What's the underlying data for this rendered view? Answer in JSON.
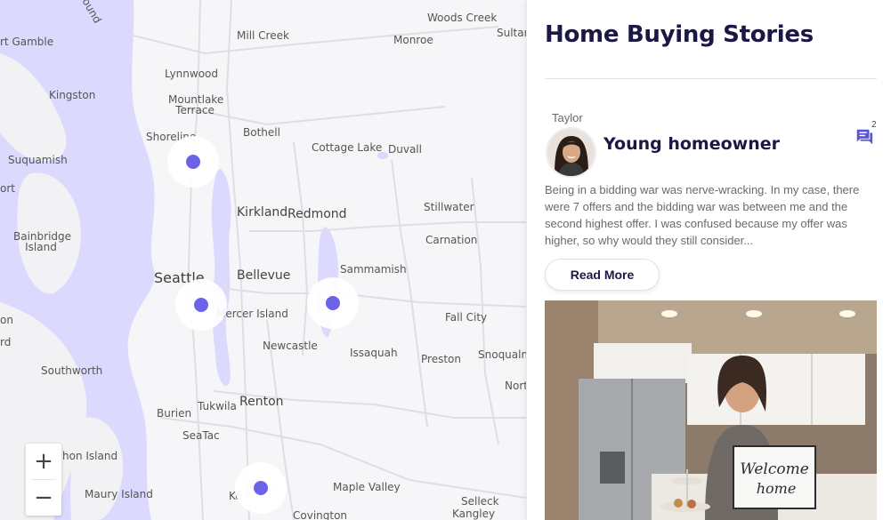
{
  "map": {
    "places": [
      {
        "name": "Woods Creek",
        "cls": ""
      },
      {
        "name": "Sultan",
        "cls": ""
      },
      {
        "name": "Monroe",
        "cls": ""
      },
      {
        "name": "Mill Creek",
        "cls": ""
      },
      {
        "name": "rt Gamble",
        "cls": ""
      },
      {
        "name": "Lynnwood",
        "cls": ""
      },
      {
        "name": "Kingston",
        "cls": ""
      },
      {
        "name": "Mountlake Terrace",
        "cls": ""
      },
      {
        "name": "Shoreline",
        "cls": ""
      },
      {
        "name": "Bothell",
        "cls": ""
      },
      {
        "name": "Cottage Lake",
        "cls": ""
      },
      {
        "name": "Duvall",
        "cls": ""
      },
      {
        "name": "Suquamish",
        "cls": ""
      },
      {
        "name": "Kirkland",
        "cls": "big"
      },
      {
        "name": "Redmond",
        "cls": "big"
      },
      {
        "name": "Stillwater",
        "cls": ""
      },
      {
        "name": "Bainbridge Island",
        "cls": ""
      },
      {
        "name": "Carnation",
        "cls": ""
      },
      {
        "name": "Sammamish",
        "cls": ""
      },
      {
        "name": "Seattle",
        "cls": "city"
      },
      {
        "name": "Bellevue",
        "cls": "big"
      },
      {
        "name": "Mercer Island",
        "cls": ""
      },
      {
        "name": "Fall City",
        "cls": ""
      },
      {
        "name": "Newcastle",
        "cls": ""
      },
      {
        "name": "Issaquah",
        "cls": ""
      },
      {
        "name": "Preston",
        "cls": ""
      },
      {
        "name": "Snoqualm",
        "cls": ""
      },
      {
        "name": "Southworth",
        "cls": ""
      },
      {
        "name": "Nort",
        "cls": ""
      },
      {
        "name": "Tukwila",
        "cls": ""
      },
      {
        "name": "Renton",
        "cls": "big"
      },
      {
        "name": "Burien",
        "cls": ""
      },
      {
        "name": "SeaTac",
        "cls": ""
      },
      {
        "name": "hon Island",
        "cls": ""
      },
      {
        "name": "Maury Island",
        "cls": ""
      },
      {
        "name": "Maple Valley",
        "cls": ""
      },
      {
        "name": "Selleck",
        "cls": ""
      },
      {
        "name": "Kangley",
        "cls": ""
      },
      {
        "name": "Covington",
        "cls": ""
      },
      {
        "name": "ound",
        "cls": ""
      },
      {
        "name": "on",
        "cls": ""
      },
      {
        "name": "rd",
        "cls": ""
      },
      {
        "name": "ort",
        "cls": ""
      },
      {
        "name": "Ke",
        "cls": ""
      }
    ],
    "pins": [
      "story-pin-shoreline",
      "story-pin-seattle",
      "story-pin-sammamish",
      "story-pin-kent"
    ],
    "zoom_in": "+",
    "zoom_out": "−",
    "accent": "#6b63ea"
  },
  "panel": {
    "title": "Home Buying Stories",
    "story": {
      "author": "Taylor",
      "title": "Young homeowner",
      "comment_count": "2",
      "excerpt": "Being in a bidding war was nerve-wracking. In my case, there were 7 offers and the bidding war was between me and the second highest offer. I was confused because my offer was higher, so why would they still consider...",
      "read_more": "Read More",
      "sign_line1": "Welcome",
      "sign_line2": "home"
    }
  }
}
